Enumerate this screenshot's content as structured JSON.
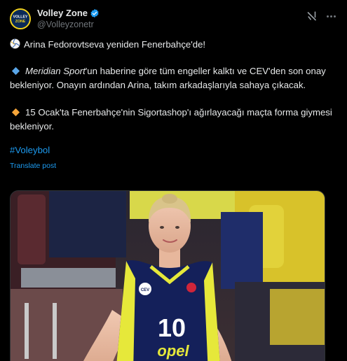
{
  "author": {
    "display_name": "Volley Zone",
    "handle": "@Volleyzonetr",
    "avatar_text": "VOLLEY ZONE",
    "verified": true
  },
  "post": {
    "line1": "Arina Fedorovtseva yeniden Fenerbahçe'de!",
    "line2_italic": "Meridian Sport",
    "line2_rest": "'un haberine göre tüm engeller kalktı ve CEV'den son onay bekleniyor. Onayın ardından Arina, takım arkadaşlarıyla sahaya çıkacak.",
    "line3": "15 Ocak'ta Fenerbahçe'nin Sigortashop'ı ağırlayacağı maçta forma giymesi bekleniyor.",
    "hashtag": "#Voleybol",
    "translate": "Translate post"
  },
  "media": {
    "jersey_number": "10",
    "jersey_sponsor": "opel",
    "jersey_badge": "CEV"
  },
  "icons": {
    "verified": "verified-badge-icon",
    "grok": "grok-icon",
    "more": "more-icon",
    "ball": "volleyball-emoji",
    "diamond_blue": "blue-diamond-emoji",
    "diamond_orange": "orange-diamond-emoji"
  },
  "colors": {
    "background": "#000000",
    "text": "#e7e9ea",
    "muted": "#71767b",
    "link": "#1d9bf0",
    "verified": "#1d9bf0",
    "jersey_yellow": "#e6e83a",
    "jersey_navy": "#14205a"
  }
}
